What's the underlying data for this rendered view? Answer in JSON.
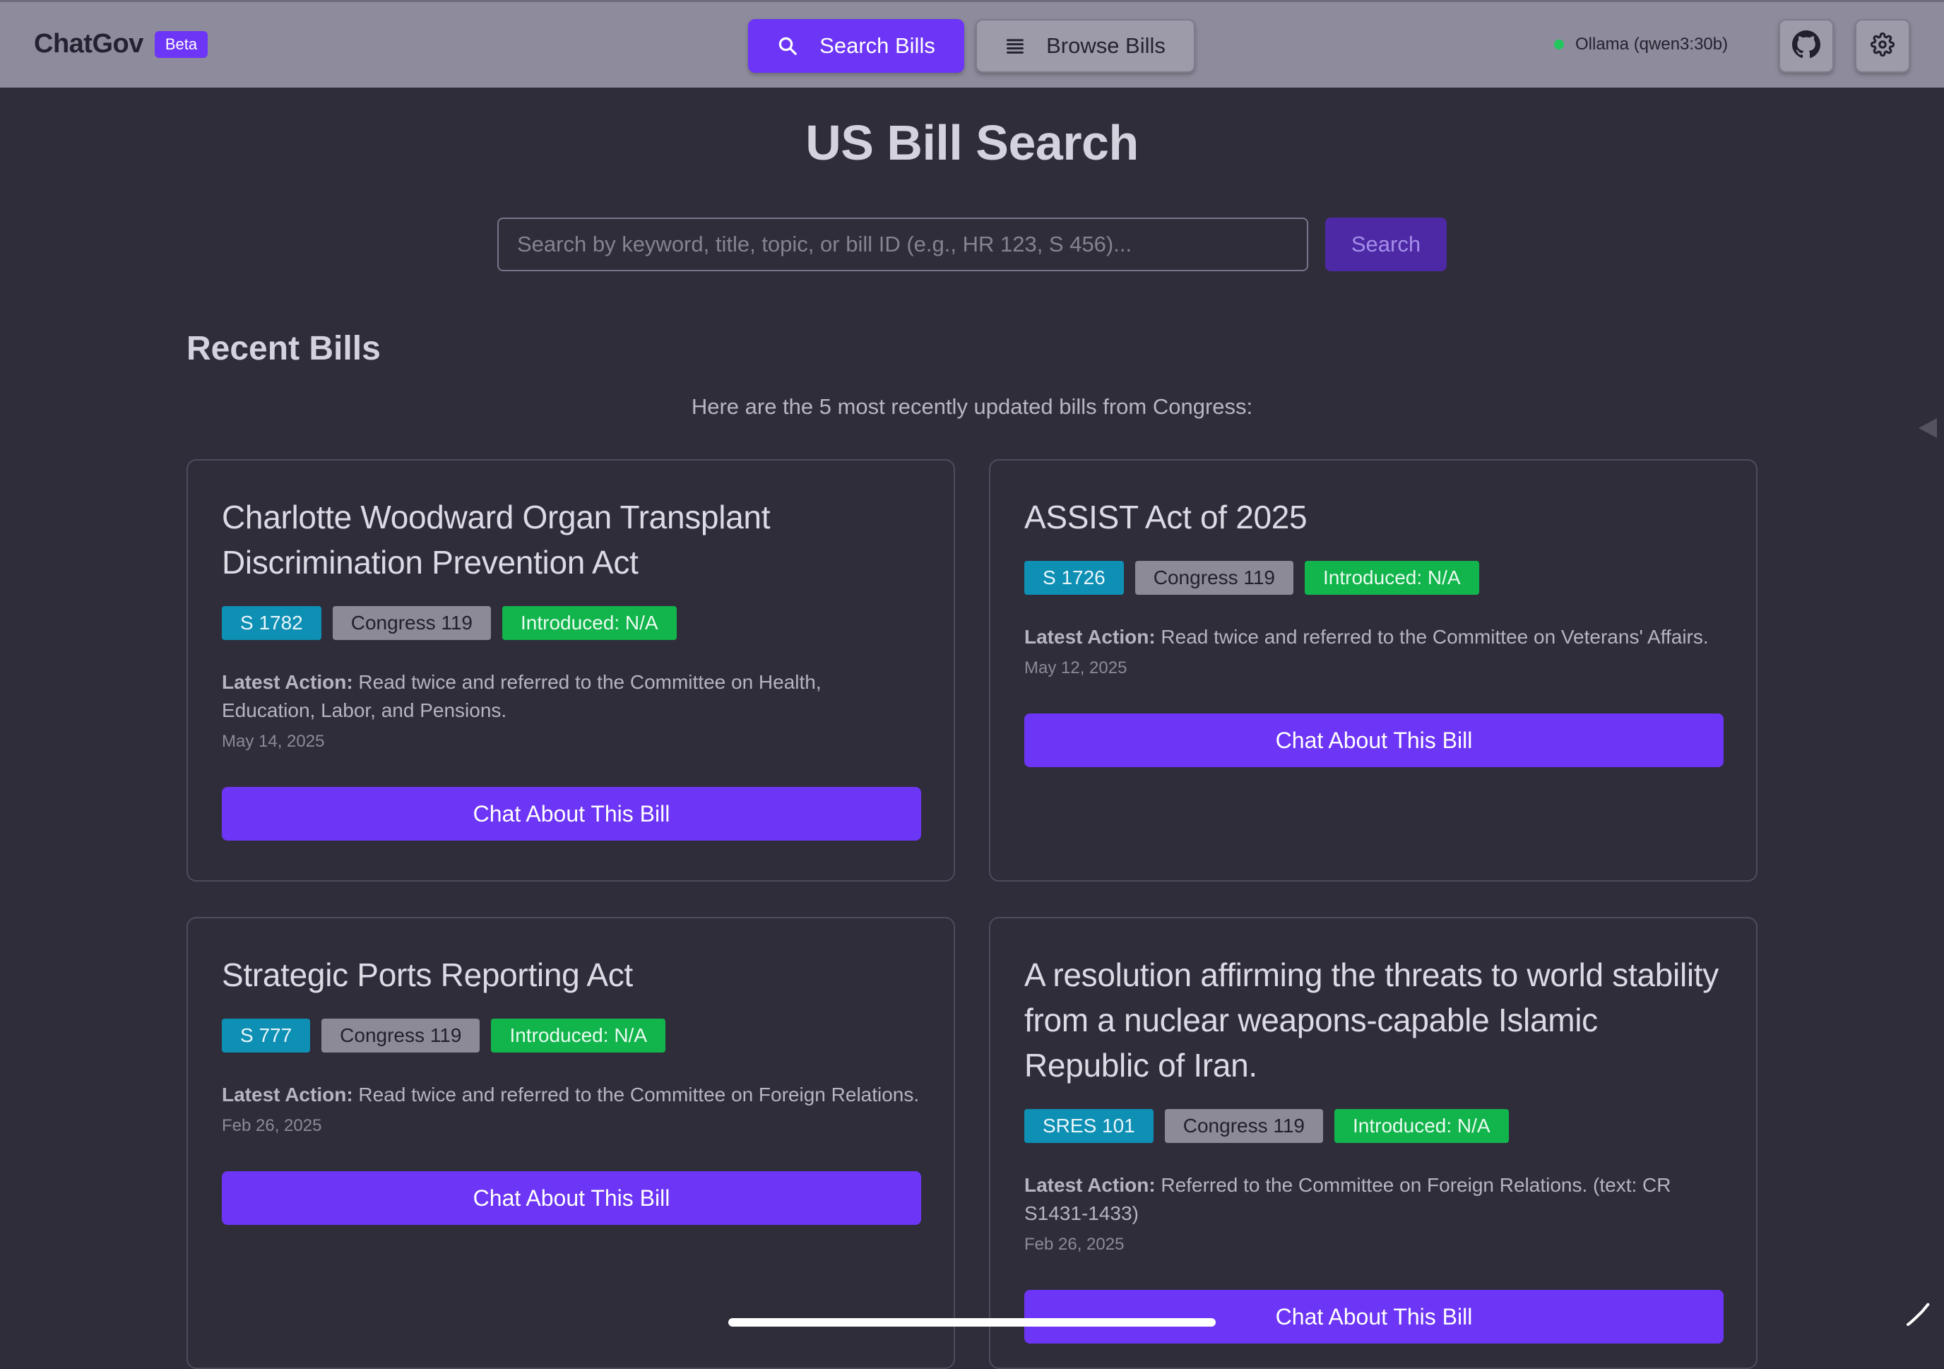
{
  "header": {
    "brand": "ChatGov",
    "badge": "Beta",
    "nav": {
      "search_label": "Search Bills",
      "browse_label": "Browse Bills"
    },
    "status": "Ollama (qwen3:30b)"
  },
  "main": {
    "title": "US Bill Search",
    "search": {
      "placeholder": "Search by keyword, title, topic, or bill ID (e.g., HR 123, S 456)...",
      "value": "",
      "button_label": "Search"
    },
    "section_title": "Recent Bills",
    "section_subtitle": "Here are the 5 most recently updated bills from Congress:"
  },
  "bills": [
    {
      "title": "Charlotte Woodward Organ Transplant Discrimination Prevention Act",
      "id": "S 1782",
      "congress": "Congress 119",
      "introduced": "Introduced: N/A",
      "latest_label": "Latest Action:",
      "latest_action": "Read twice and referred to the Committee on Health, Education, Labor, and Pensions.",
      "date": "May 14, 2025",
      "button_label": "Chat About This Bill"
    },
    {
      "title": "ASSIST Act of 2025",
      "id": "S 1726",
      "congress": "Congress 119",
      "introduced": "Introduced: N/A",
      "latest_label": "Latest Action:",
      "latest_action": "Read twice and referred to the Committee on Veterans' Affairs.",
      "date": "May 12, 2025",
      "button_label": "Chat About This Bill"
    },
    {
      "title": "Strategic Ports Reporting Act",
      "id": "S 777",
      "congress": "Congress 119",
      "introduced": "Introduced: N/A",
      "latest_label": "Latest Action:",
      "latest_action": "Read twice and referred to the Committee on Foreign Relations.",
      "date": "Feb 26, 2025",
      "button_label": "Chat About This Bill"
    },
    {
      "title": "A resolution affirming the threats to world stability from a nuclear weapons-capable Islamic Republic of Iran.",
      "id": "SRES 101",
      "congress": "Congress 119",
      "introduced": "Introduced: N/A",
      "latest_label": "Latest Action:",
      "latest_action": "Referred to the Committee on Foreign Relations. (text: CR S1431-1433)",
      "date": "Feb 26, 2025",
      "button_label": "Chat About This Bill"
    }
  ],
  "icons": {
    "nav_search": "search-icon",
    "nav_browse": "list-icon",
    "github": "github-icon",
    "settings": "gear-icon",
    "status": "status-dot"
  },
  "colors": {
    "accent": "#6d35f5",
    "header_bg": "#8e8c9c",
    "page_bg": "#302d3b",
    "badge_id": "#0e8fb4",
    "badge_congress": "#8c8a97",
    "badge_introduced": "#12b44c",
    "status_online": "#22c55e"
  }
}
